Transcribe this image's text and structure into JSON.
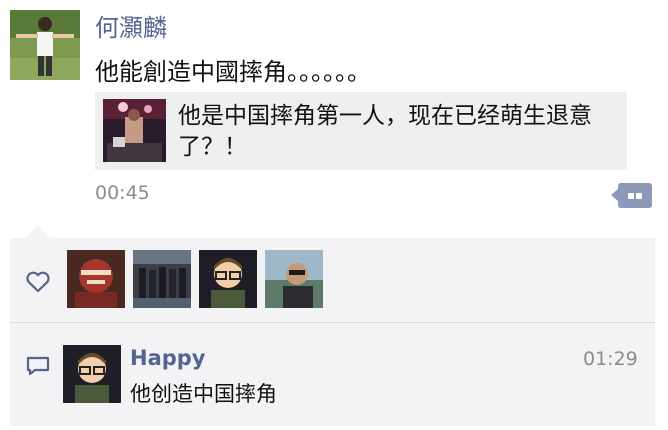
{
  "post": {
    "author": "何灝麟",
    "text": "他能創造中國摔角。。。。。。",
    "time": "00:45",
    "shared_link": {
      "title": "他是中国摔角第一人，现在已经萌生退意了？！"
    }
  },
  "likes": {
    "icon": "heart-outline-icon",
    "liker_count": 4
  },
  "comments": [
    {
      "name": "Happy",
      "time": "01:29",
      "text": "他创造中国摔角"
    }
  ],
  "colors": {
    "name_blue": "#55638f",
    "timestamp_gray": "#8c8c8c",
    "panel_bg": "#f3f3f5",
    "card_bg": "#efefef",
    "comment_button": "#8e98b8"
  }
}
